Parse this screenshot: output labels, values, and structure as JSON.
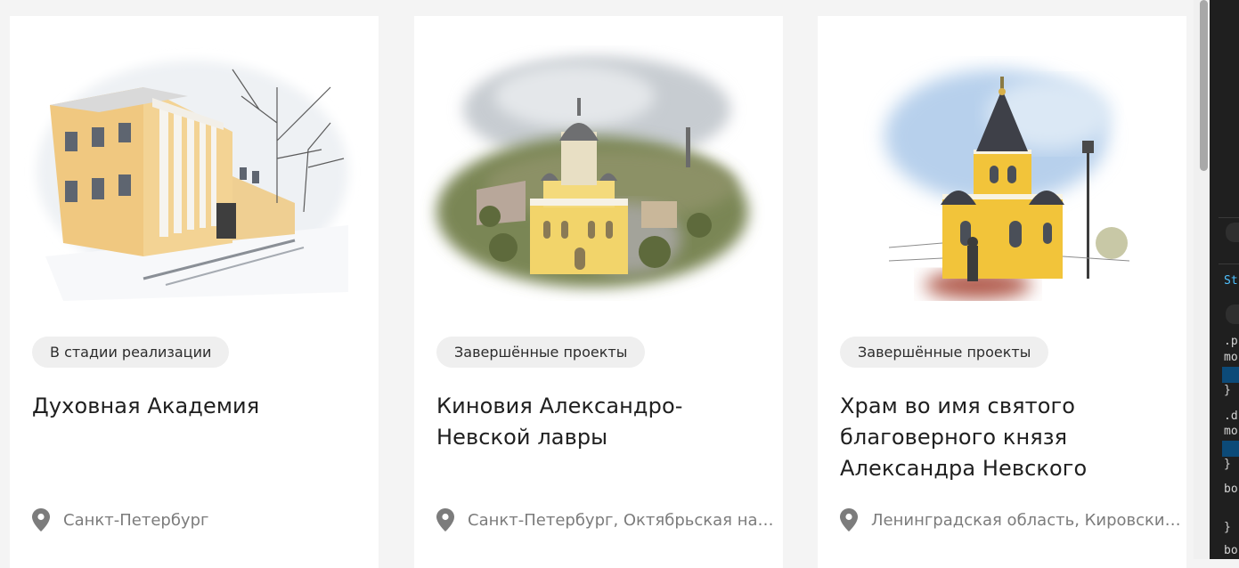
{
  "cards": [
    {
      "badge": "В стадии реализации",
      "title": "Духовная Академия",
      "location": "Санкт-Петербург",
      "image_icon": "academy-building-illustration"
    },
    {
      "badge": "Завершённые проекты",
      "title": "Киновия Александро-Невской лавры",
      "location": "Санкт-Петербург, Октябрьская наб...",
      "image_icon": "church-aerial-illustration"
    },
    {
      "badge": "Завершённые проекты",
      "title": "Храм во имя святого благоверного князя Александра Невского",
      "location": "Ленинградская область, Кировский...",
      "image_icon": "chapel-illustration"
    }
  ],
  "icons": {
    "location": "map-pin-icon"
  },
  "devtools": {
    "lines": [
      "St",
      ".p",
      "mo",
      "}",
      ".d",
      "mo",
      "}",
      "bo",
      "}",
      "bo"
    ],
    "colors": {
      "panel": "#1f1f1f",
      "highlight": "#0c4a78",
      "accent": "#4fc1ff"
    }
  },
  "colors": {
    "background": "#f4f4f4",
    "card": "#ffffff",
    "badge": "#efefef",
    "title": "#1f1f1f",
    "location": "#7c7c7c"
  }
}
